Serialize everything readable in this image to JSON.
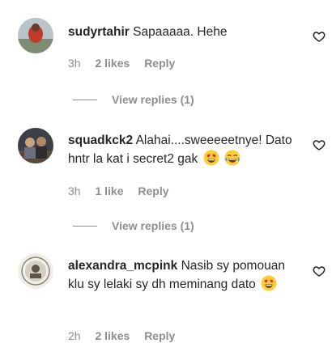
{
  "comments": [
    {
      "username": "sudyrtahir",
      "text": "Sapaaaaa. Hehe",
      "time": "3h",
      "likes": "2 likes",
      "reply": "Reply",
      "view_replies": "View replies (1)",
      "avatar_color": "#c0392b",
      "emojis": []
    },
    {
      "username": "squadkck2",
      "text": "Alahai....sweeeeetnye! Dato hntr la kat i secret2 gak",
      "time": "3h",
      "likes": "1 like",
      "reply": "Reply",
      "view_replies": "View replies (1)",
      "avatar_color": "#4a4a4a",
      "emojis": [
        "heart-eyes-emoji",
        "tears-of-joy-emoji"
      ]
    },
    {
      "username": "alexandra_mcpink",
      "text": "Nasib sy pomouan klu sy lelaki sy dh meminang dato",
      "time": "2h",
      "likes": "2 likes",
      "reply": "Reply",
      "avatar_color": "#d6d0c4",
      "emojis": [
        "heart-eyes-emoji"
      ]
    }
  ],
  "colors": {
    "text": "#262626",
    "secondary": "#8e8e8e",
    "emoji_face": "#ffcc33",
    "emoji_heart": "#e8113c"
  }
}
